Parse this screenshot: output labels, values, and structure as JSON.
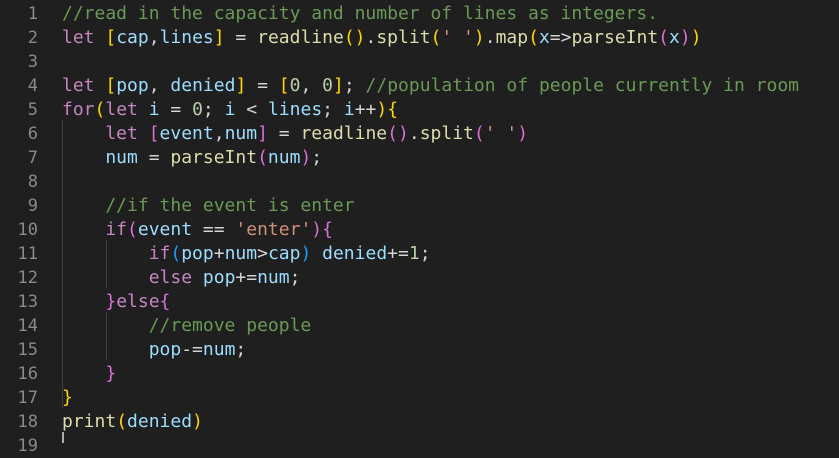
{
  "editor": {
    "line_numbers": [
      "1",
      "2",
      "3",
      "4",
      "5",
      "6",
      "7",
      "8",
      "9",
      "10",
      "11",
      "12",
      "13",
      "14",
      "15",
      "16",
      "17",
      "18",
      "19"
    ],
    "lines": [
      [
        {
          "t": "//read in the capacity and number of lines as integers.",
          "c": "comment"
        }
      ],
      [
        {
          "t": "let ",
          "c": "keyword"
        },
        {
          "t": "[",
          "c": "br1"
        },
        {
          "t": "cap",
          "c": "var"
        },
        {
          "t": ",",
          "c": "op"
        },
        {
          "t": "lines",
          "c": "var"
        },
        {
          "t": "]",
          "c": "br1"
        },
        {
          "t": " = ",
          "c": "op"
        },
        {
          "t": "readline",
          "c": "func"
        },
        {
          "t": "()",
          "c": "br1"
        },
        {
          "t": ".",
          "c": "op"
        },
        {
          "t": "split",
          "c": "func"
        },
        {
          "t": "(",
          "c": "br1"
        },
        {
          "t": "' '",
          "c": "string"
        },
        {
          "t": ")",
          "c": "br1"
        },
        {
          "t": ".",
          "c": "op"
        },
        {
          "t": "map",
          "c": "func"
        },
        {
          "t": "(",
          "c": "br1"
        },
        {
          "t": "x",
          "c": "var"
        },
        {
          "t": "=>",
          "c": "op"
        },
        {
          "t": "parseInt",
          "c": "func"
        },
        {
          "t": "(",
          "c": "br2"
        },
        {
          "t": "x",
          "c": "var"
        },
        {
          "t": ")",
          "c": "br2"
        },
        {
          "t": ")",
          "c": "br1"
        }
      ],
      [],
      [
        {
          "t": "let ",
          "c": "keyword"
        },
        {
          "t": "[",
          "c": "br1"
        },
        {
          "t": "pop",
          "c": "var"
        },
        {
          "t": ", ",
          "c": "op"
        },
        {
          "t": "denied",
          "c": "var"
        },
        {
          "t": "]",
          "c": "br1"
        },
        {
          "t": " = ",
          "c": "op"
        },
        {
          "t": "[",
          "c": "br1"
        },
        {
          "t": "0",
          "c": "number"
        },
        {
          "t": ", ",
          "c": "op"
        },
        {
          "t": "0",
          "c": "number"
        },
        {
          "t": "]",
          "c": "br1"
        },
        {
          "t": "; ",
          "c": "op"
        },
        {
          "t": "//population of people currently in room",
          "c": "comment"
        }
      ],
      [
        {
          "t": "for",
          "c": "keyword"
        },
        {
          "t": "(",
          "c": "br1"
        },
        {
          "t": "let ",
          "c": "keyword"
        },
        {
          "t": "i",
          "c": "var"
        },
        {
          "t": " = ",
          "c": "op"
        },
        {
          "t": "0",
          "c": "number"
        },
        {
          "t": "; ",
          "c": "op"
        },
        {
          "t": "i",
          "c": "var"
        },
        {
          "t": " < ",
          "c": "op"
        },
        {
          "t": "lines",
          "c": "var"
        },
        {
          "t": "; ",
          "c": "op"
        },
        {
          "t": "i",
          "c": "var"
        },
        {
          "t": "++",
          "c": "op"
        },
        {
          "t": ")",
          "c": "br1"
        },
        {
          "t": "{",
          "c": "br1"
        }
      ],
      [
        {
          "t": "    let ",
          "c": "keyword"
        },
        {
          "t": "[",
          "c": "br2"
        },
        {
          "t": "event",
          "c": "var"
        },
        {
          "t": ",",
          "c": "op"
        },
        {
          "t": "num",
          "c": "var"
        },
        {
          "t": "]",
          "c": "br2"
        },
        {
          "t": " = ",
          "c": "op"
        },
        {
          "t": "readline",
          "c": "func"
        },
        {
          "t": "()",
          "c": "br2"
        },
        {
          "t": ".",
          "c": "op"
        },
        {
          "t": "split",
          "c": "func"
        },
        {
          "t": "(",
          "c": "br2"
        },
        {
          "t": "' '",
          "c": "string"
        },
        {
          "t": ")",
          "c": "br2"
        }
      ],
      [
        {
          "t": "    num",
          "c": "var"
        },
        {
          "t": " = ",
          "c": "op"
        },
        {
          "t": "parseInt",
          "c": "func"
        },
        {
          "t": "(",
          "c": "br2"
        },
        {
          "t": "num",
          "c": "var"
        },
        {
          "t": ")",
          "c": "br2"
        },
        {
          "t": ";",
          "c": "op"
        }
      ],
      [],
      [
        {
          "t": "    //if the event is enter",
          "c": "comment"
        }
      ],
      [
        {
          "t": "    if",
          "c": "keyword"
        },
        {
          "t": "(",
          "c": "br2"
        },
        {
          "t": "event",
          "c": "var"
        },
        {
          "t": " == ",
          "c": "op"
        },
        {
          "t": "'enter'",
          "c": "string"
        },
        {
          "t": ")",
          "c": "br2"
        },
        {
          "t": "{",
          "c": "br2"
        }
      ],
      [
        {
          "t": "        if",
          "c": "keyword"
        },
        {
          "t": "(",
          "c": "br3"
        },
        {
          "t": "pop",
          "c": "var"
        },
        {
          "t": "+",
          "c": "op"
        },
        {
          "t": "num",
          "c": "var"
        },
        {
          "t": ">",
          "c": "op"
        },
        {
          "t": "cap",
          "c": "var"
        },
        {
          "t": ")",
          "c": "br3"
        },
        {
          "t": " denied",
          "c": "var"
        },
        {
          "t": "+=",
          "c": "op"
        },
        {
          "t": "1",
          "c": "number"
        },
        {
          "t": ";",
          "c": "op"
        }
      ],
      [
        {
          "t": "        else ",
          "c": "keyword"
        },
        {
          "t": "pop",
          "c": "var"
        },
        {
          "t": "+=",
          "c": "op"
        },
        {
          "t": "num",
          "c": "var"
        },
        {
          "t": ";",
          "c": "op"
        }
      ],
      [
        {
          "t": "    }",
          "c": "br2"
        },
        {
          "t": "else",
          "c": "keyword"
        },
        {
          "t": "{",
          "c": "br2"
        }
      ],
      [
        {
          "t": "        //remove people",
          "c": "comment"
        }
      ],
      [
        {
          "t": "        pop",
          "c": "var"
        },
        {
          "t": "-=",
          "c": "op"
        },
        {
          "t": "num",
          "c": "var"
        },
        {
          "t": ";",
          "c": "op"
        }
      ],
      [
        {
          "t": "    }",
          "c": "br2"
        }
      ],
      [
        {
          "t": "}",
          "c": "br1"
        }
      ],
      [
        {
          "t": "print",
          "c": "func"
        },
        {
          "t": "(",
          "c": "br1"
        },
        {
          "t": "denied",
          "c": "var"
        },
        {
          "t": ")",
          "c": "br1"
        }
      ],
      []
    ]
  }
}
